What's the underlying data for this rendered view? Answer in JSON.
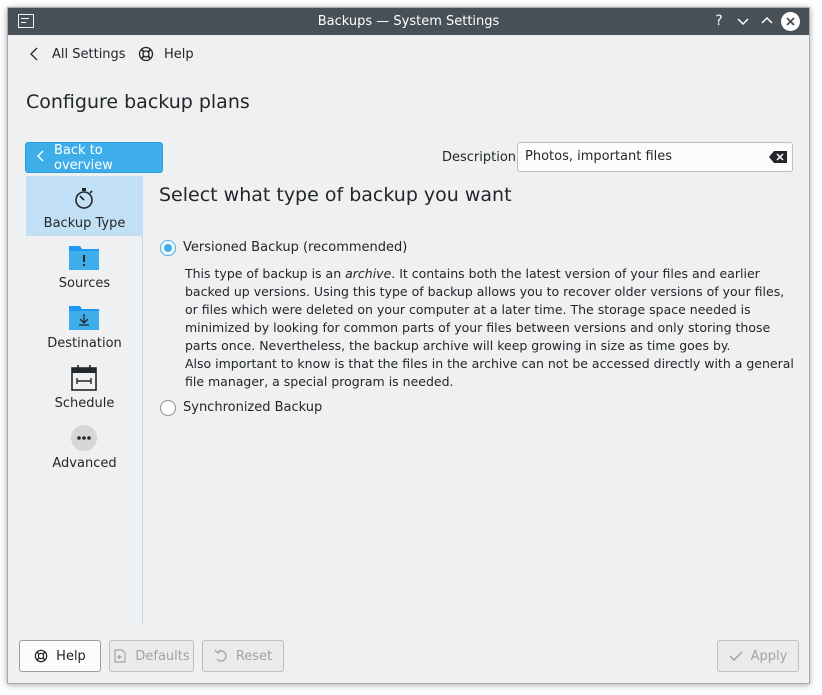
{
  "window": {
    "title": "Backups — System Settings"
  },
  "titlebar": {
    "help": "?",
    "minimize": "⌄",
    "maximize": "⌃",
    "close": "✕"
  },
  "nav": {
    "all_settings": "All Settings",
    "help": "Help"
  },
  "page": {
    "title": "Configure backup plans"
  },
  "back_button": {
    "label": "Back to overview"
  },
  "description": {
    "label": "Description:",
    "value": "Photos, important files"
  },
  "sidebar": {
    "items": [
      {
        "label": "Backup Type",
        "icon": "stopwatch-icon",
        "active": true
      },
      {
        "label": "Sources",
        "icon": "folder-important-icon"
      },
      {
        "label": "Destination",
        "icon": "folder-download-icon"
      },
      {
        "label": "Schedule",
        "icon": "calendar-icon"
      },
      {
        "label": "Advanced",
        "icon": "more-icon"
      }
    ]
  },
  "content": {
    "title": "Select what type of backup you want",
    "option_versioned": "Versioned Backup (recommended)",
    "versioned_desc_1": "This type of backup is an ",
    "versioned_desc_em": "archive",
    "versioned_desc_2": ". It contains both the latest version of your files and earlier backed up versions. Using this type of backup allows you to recover older versions of your files, or files which were deleted on your computer at a later time. The storage space needed is minimized by looking for common parts of your files between versions and only storing those parts once. Nevertheless, the backup archive will keep growing in size as time goes by.",
    "versioned_desc_3": "Also important to know is that the files in the archive can not be accessed directly with a general file manager, a special program is needed.",
    "option_synchronized": "Synchronized Backup"
  },
  "footer": {
    "help": "Help",
    "defaults": "Defaults",
    "reset": "Reset",
    "apply": "Apply"
  },
  "colors": {
    "accent": "#3daee9",
    "titlebar": "#475057",
    "selection": "#c2e0f5"
  }
}
